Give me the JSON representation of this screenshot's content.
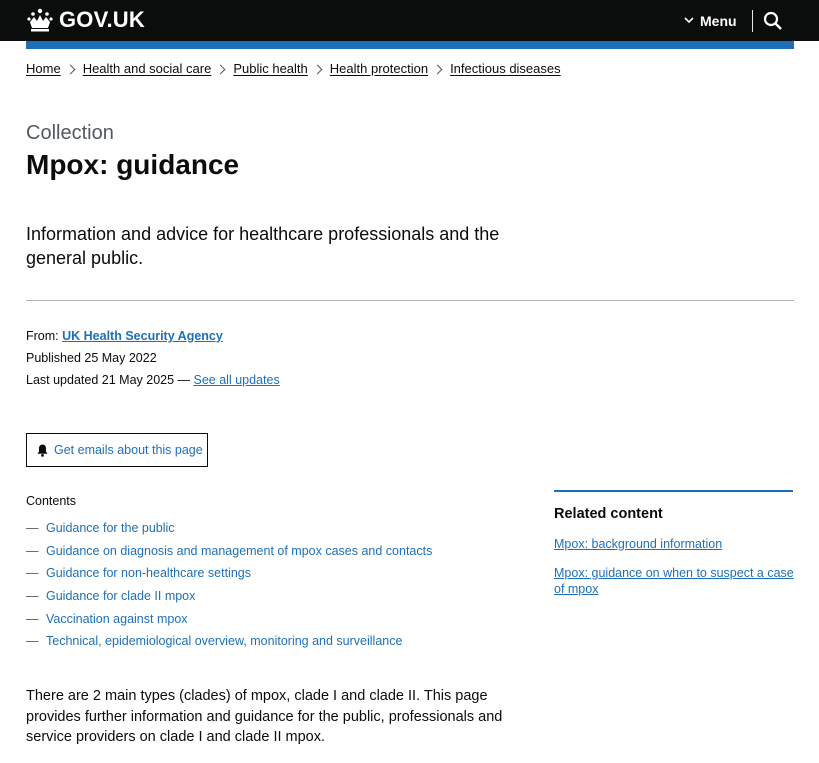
{
  "header": {
    "logo_text": "GOV.UK",
    "menu_label": "Menu",
    "crown_icon": "crown-icon",
    "search_icon": "search-icon",
    "colors": {
      "header_bg": "#0b0c0c",
      "brand_blue": "#1d70b8"
    }
  },
  "breadcrumb": [
    "Home",
    "Health and social care",
    "Public health",
    "Health protection",
    "Infectious diseases"
  ],
  "page": {
    "caption": "Collection",
    "title": "Mpox: guidance",
    "lede": "Information and advice for healthcare professionals and the general public."
  },
  "meta": {
    "from_label": "From:",
    "from_org": "UK Health Security Agency",
    "published_label": "Published",
    "published_date": "25 May 2022",
    "updated_label": "Last updated",
    "updated_date": "21 May 2025 —",
    "see_all_updates": "See all updates"
  },
  "email_button": {
    "label": "Get emails about this page",
    "icon": "bell-icon"
  },
  "contents": {
    "heading": "Contents",
    "items": [
      "Guidance for the public",
      "Guidance on diagnosis and management of mpox cases and contacts",
      "Guidance for non-healthcare settings",
      "Guidance for clade II mpox",
      "Vaccination against mpox",
      "Technical, epidemiological overview, monitoring and surveillance"
    ]
  },
  "body_paragraph": "There are 2 main types (clades) of mpox, clade I and clade II. This page provides further information and guidance for the public, professionals and service providers on clade I and clade II mpox.",
  "related": {
    "heading": "Related content",
    "links": [
      "Mpox: background information",
      "Mpox: guidance on when to suspect a case of mpox"
    ]
  }
}
